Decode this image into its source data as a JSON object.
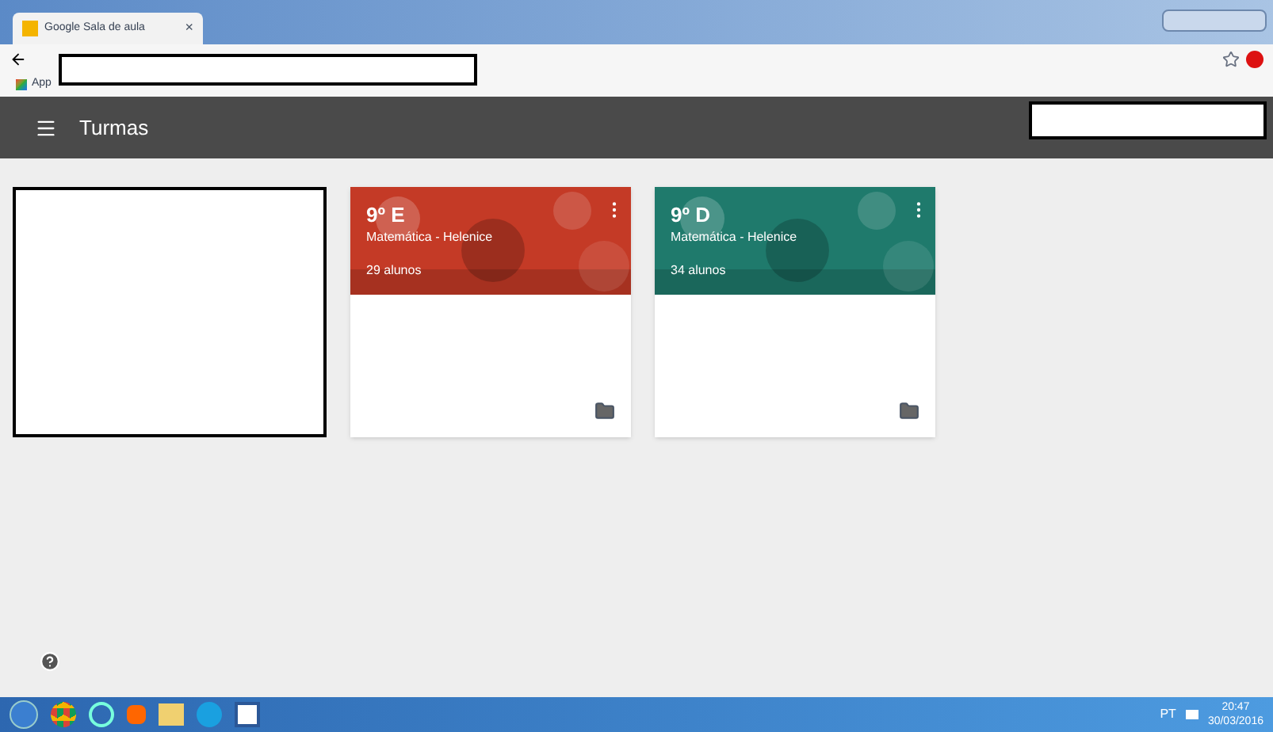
{
  "browser": {
    "tab_title": "Google Sala de aula",
    "tab_close": "×",
    "bookmarks_label": "App"
  },
  "header": {
    "title": "Turmas"
  },
  "cards": [
    {
      "title": "9º E",
      "subtitle": "Matemática - Helenice",
      "count": "29 alunos",
      "color": "#c43a26"
    },
    {
      "title": "9º D",
      "subtitle": "Matemática - Helenice",
      "count": "34 alunos",
      "color": "#1f7a6c"
    }
  ],
  "taskbar": {
    "language": "PT",
    "time": "20:47",
    "date": "30/03/2016"
  }
}
